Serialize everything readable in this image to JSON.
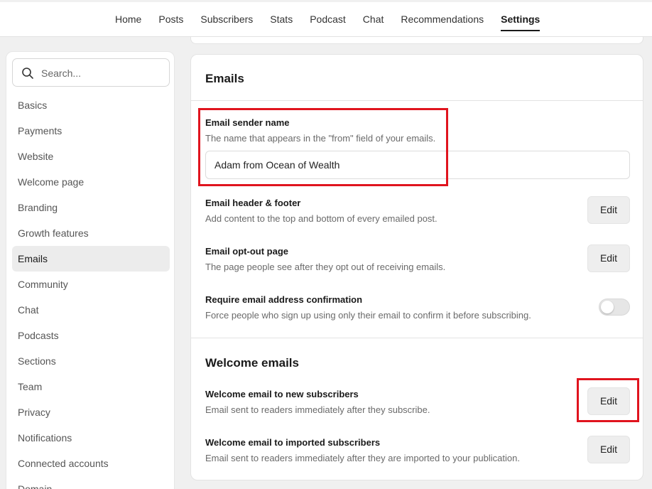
{
  "nav": {
    "tabs": [
      "Home",
      "Posts",
      "Subscribers",
      "Stats",
      "Podcast",
      "Chat",
      "Recommendations",
      "Settings"
    ],
    "active": "Settings"
  },
  "sidebar": {
    "search_placeholder": "Search...",
    "items": [
      "Basics",
      "Payments",
      "Website",
      "Welcome page",
      "Branding",
      "Growth features",
      "Emails",
      "Community",
      "Chat",
      "Podcasts",
      "Sections",
      "Team",
      "Privacy",
      "Notifications",
      "Connected accounts",
      "Domain"
    ],
    "active": "Emails"
  },
  "emails": {
    "title": "Emails",
    "sender_name": {
      "title": "Email sender name",
      "desc": "The name that appears in the \"from\" field of your emails.",
      "value": "Adam from Ocean of Wealth"
    },
    "header_footer": {
      "title": "Email header & footer",
      "desc": "Add content to the top and bottom of every emailed post.",
      "button": "Edit"
    },
    "opt_out": {
      "title": "Email opt-out page",
      "desc": "The page people see after they opt out of receiving emails.",
      "button": "Edit"
    },
    "confirmation": {
      "title": "Require email address confirmation",
      "desc": "Force people who sign up using only their email to confirm it before subscribing.",
      "enabled": false
    }
  },
  "welcome": {
    "title": "Welcome emails",
    "new_subscribers": {
      "title": "Welcome email to new subscribers",
      "desc": "Email sent to readers immediately after they subscribe.",
      "button": "Edit"
    },
    "imported": {
      "title": "Welcome email to imported subscribers",
      "desc": "Email sent to readers immediately after they are imported to your publication.",
      "button": "Edit"
    }
  },
  "colors": {
    "highlight": "#e0141e",
    "background": "#f0f0f0",
    "active_item_bg": "#ececec"
  }
}
